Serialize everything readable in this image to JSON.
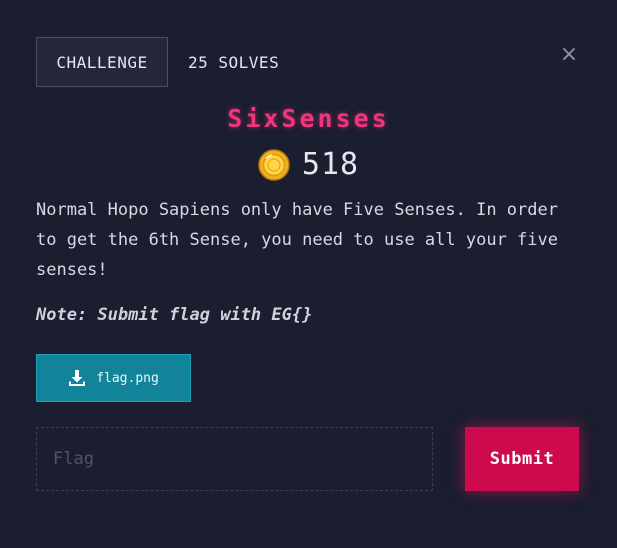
{
  "modal": {
    "tabs": [
      {
        "label": "CHALLENGE",
        "active": true
      },
      {
        "label": "25 SOLVES",
        "active": false
      }
    ],
    "close_icon": "×"
  },
  "challenge": {
    "name": "SixSenses",
    "points": "518",
    "points_icon": "coin-icon",
    "description": "Normal Hopo Sapiens only have Five Senses. In order to get the 6th Sense, you need to use all your five senses!",
    "note": "Note: Submit flag with EG{}"
  },
  "files": [
    {
      "name": "flag.png",
      "icon": "download-icon"
    }
  ],
  "submission": {
    "placeholder": "Flag",
    "value": "",
    "submit_label": "Submit"
  },
  "colors": {
    "background": "#1a1e2f",
    "title": "#f0357c",
    "file_button": "#12849a",
    "submit_button": "#cd0a4d"
  }
}
